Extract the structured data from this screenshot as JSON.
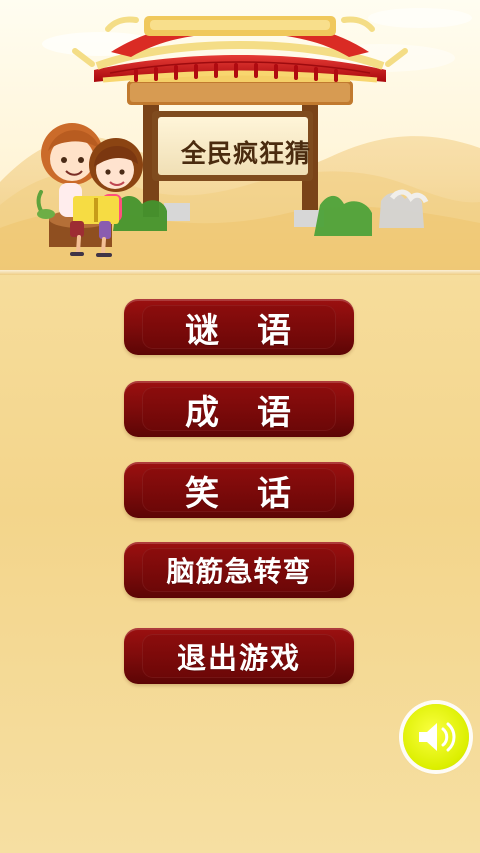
{
  "game": {
    "title": "全民疯狂猜"
  },
  "menu": {
    "riddle": "谜　语",
    "idiom": "成　语",
    "joke": "笑　话",
    "brain_teaser": "脑筋急转弯",
    "exit": "退出游戏"
  },
  "icons": {
    "sound": "sound-icon",
    "gate": "gate-icon",
    "kids": "children-reading-icon"
  },
  "colors": {
    "button_red": "#7d0b0b",
    "roof_red": "#c8151b",
    "gate_wood": "#7a4318",
    "sound_yellow": "#e4f10b"
  }
}
